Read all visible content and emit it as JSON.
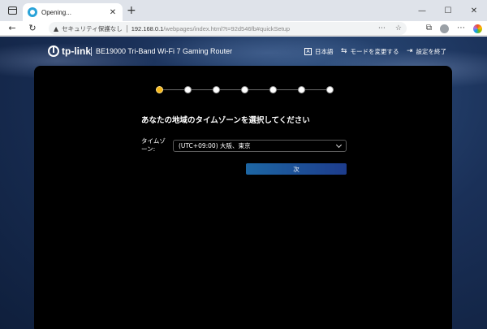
{
  "browser": {
    "tab_title": "Opening...",
    "tab_close": "✕",
    "new_tab": "+",
    "window_controls": {
      "minimize": "—",
      "maximize": "☐",
      "close": "✕"
    },
    "nav": {
      "back": "←",
      "refresh": "↻"
    },
    "security_label": "セキュリティ保護なし",
    "url_host": "192.168.0.1",
    "url_path": "/webpages/index.html?t=92d546fb#quickSetup"
  },
  "header": {
    "logo_text": "tp-link",
    "product_name": "BE19000 Tri-Band Wi-Fi 7 Gaming Router",
    "language_label": "日本語",
    "mode_label": "モードを変更する",
    "exit_label": "設定を終了"
  },
  "setup": {
    "total_steps": 7,
    "current_step": 1,
    "question": "あなたの地域のタイムゾーンを選択してください",
    "timezone_label": "タイムゾーン:",
    "timezone_value": "(UTC+09:00) 大阪、東京",
    "next_label": "次"
  },
  "colors": {
    "active_step": "#f6b81a",
    "button": "#1d66a3",
    "panel": "#000000"
  }
}
